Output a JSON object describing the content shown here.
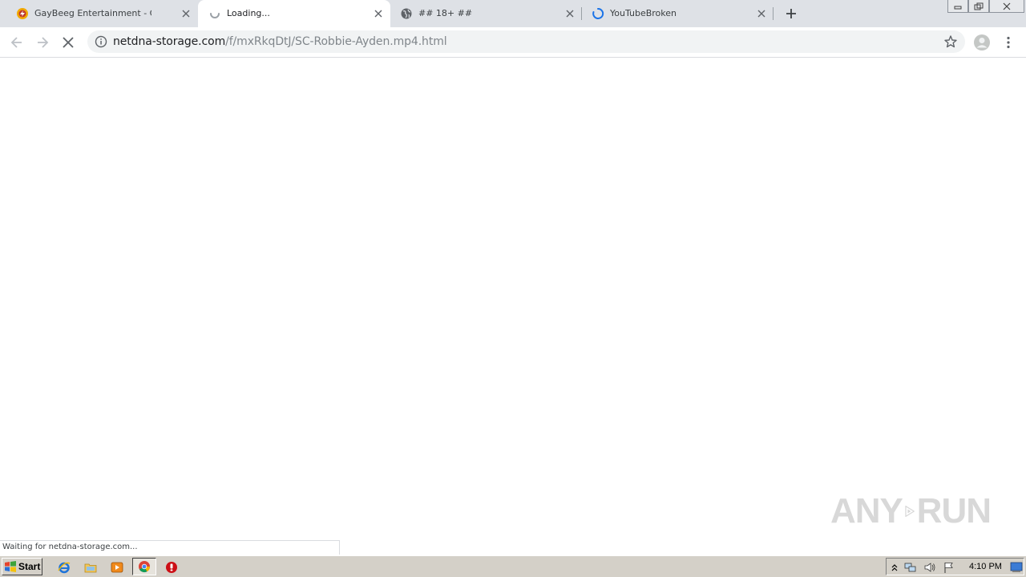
{
  "browser": {
    "tabs": [
      {
        "title": "GayBeeg Entertainment - Gay Porn E",
        "icon": "site-favicon",
        "active": false
      },
      {
        "title": "Loading...",
        "icon": "loading-spinner-icon",
        "active": true
      },
      {
        "title": "## 18+ ##",
        "icon": "globe-icon",
        "active": false
      },
      {
        "title": "YouTubeBroken",
        "icon": "loading-spinner-icon",
        "active": false
      }
    ],
    "address": {
      "host": "netdna-storage.com",
      "path": "/f/mxRkqDtJ/SC-Robbie-Ayden.mp4.html"
    },
    "status_text": "Waiting for netdna-storage.com..."
  },
  "watermark": {
    "left": "ANY",
    "right": "RUN"
  },
  "taskbar": {
    "start_label": "Start",
    "clock": "4:10 PM"
  },
  "colors": {
    "tab_strip": "#dee1e6",
    "accent_blue": "#1a73e8",
    "taskbar": "#d4d0c8"
  }
}
